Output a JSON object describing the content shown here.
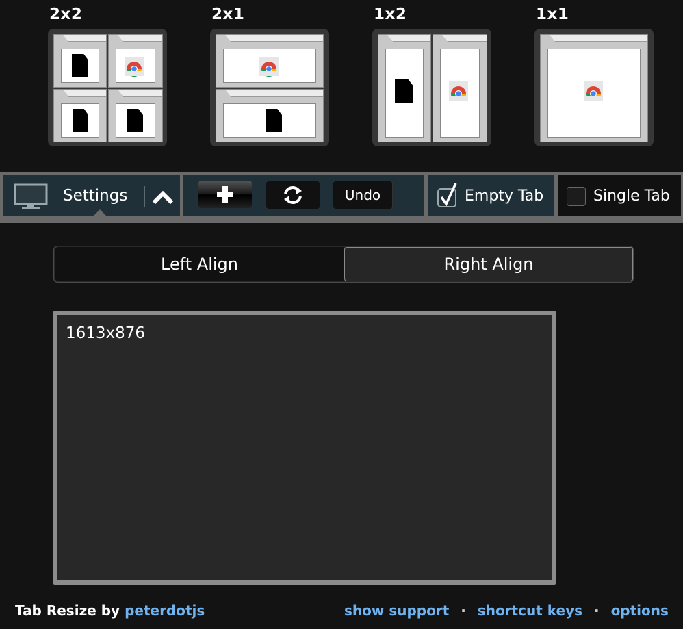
{
  "layouts": [
    {
      "label": "2x2"
    },
    {
      "label": "2x1"
    },
    {
      "label": "1x2"
    },
    {
      "label": "1x1"
    }
  ],
  "toolbar": {
    "settings_label": "Settings",
    "undo_label": "Undo",
    "empty_tab_label": "Empty Tab",
    "empty_tab_checked": true,
    "single_tab_label": "Single Tab",
    "single_tab_checked": false
  },
  "align": {
    "left_label": "Left Align",
    "right_label": "Right Align",
    "selected": "right"
  },
  "preview": {
    "resolution": "1613x876"
  },
  "footer": {
    "brand": "Tab Resize by",
    "author": "peterdotjs",
    "show_support": "show support",
    "separator": "·",
    "shortcut_keys": "shortcut keys",
    "options": "options"
  },
  "colors": {
    "background": "#131313",
    "toolbar_segment": "#1f3038",
    "link": "#6fb3f0"
  }
}
